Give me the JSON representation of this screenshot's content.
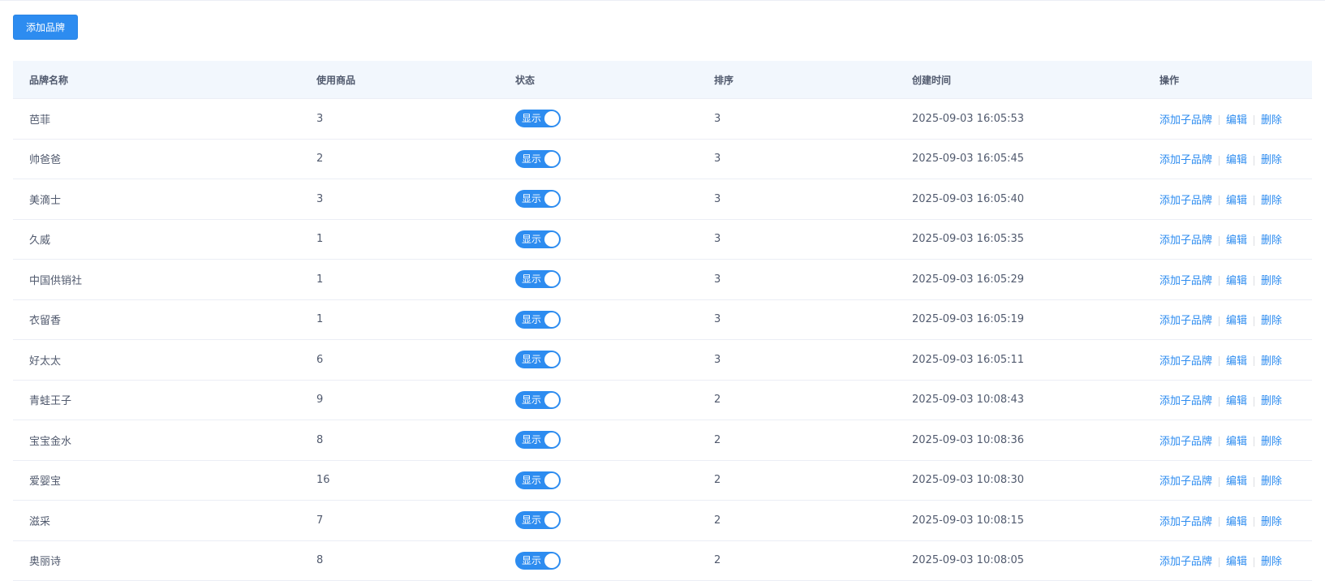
{
  "toolbar": {
    "add_brand_label": "添加品牌"
  },
  "table": {
    "columns": {
      "name": "品牌名称",
      "count": "使用商品",
      "status": "状态",
      "sort": "排序",
      "created": "创建时间",
      "ops": "操作"
    },
    "actions": {
      "add_sub": "添加子品牌",
      "edit": "编辑",
      "delete": "删除"
    },
    "rows": [
      {
        "name": "芭菲",
        "count": "3",
        "status": "显示",
        "sort": "3",
        "created": "2025-09-03 16:05:53"
      },
      {
        "name": "帅爸爸",
        "count": "2",
        "status": "显示",
        "sort": "3",
        "created": "2025-09-03 16:05:45"
      },
      {
        "name": "美滴士",
        "count": "3",
        "status": "显示",
        "sort": "3",
        "created": "2025-09-03 16:05:40"
      },
      {
        "name": "久威",
        "count": "1",
        "status": "显示",
        "sort": "3",
        "created": "2025-09-03 16:05:35"
      },
      {
        "name": "中国供销社",
        "count": "1",
        "status": "显示",
        "sort": "3",
        "created": "2025-09-03 16:05:29"
      },
      {
        "name": "衣留香",
        "count": "1",
        "status": "显示",
        "sort": "3",
        "created": "2025-09-03 16:05:19"
      },
      {
        "name": "好太太",
        "count": "6",
        "status": "显示",
        "sort": "3",
        "created": "2025-09-03 16:05:11"
      },
      {
        "name": "青蛙王子",
        "count": "9",
        "status": "显示",
        "sort": "2",
        "created": "2025-09-03 10:08:43"
      },
      {
        "name": "宝宝金水",
        "count": "8",
        "status": "显示",
        "sort": "2",
        "created": "2025-09-03 10:08:36"
      },
      {
        "name": "爱婴宝",
        "count": "16",
        "status": "显示",
        "sort": "2",
        "created": "2025-09-03 10:08:30"
      },
      {
        "name": "滋采",
        "count": "7",
        "status": "显示",
        "sort": "2",
        "created": "2025-09-03 10:08:15"
      },
      {
        "name": "奥丽诗",
        "count": "8",
        "status": "显示",
        "sort": "2",
        "created": "2025-09-03 10:08:05"
      }
    ]
  }
}
